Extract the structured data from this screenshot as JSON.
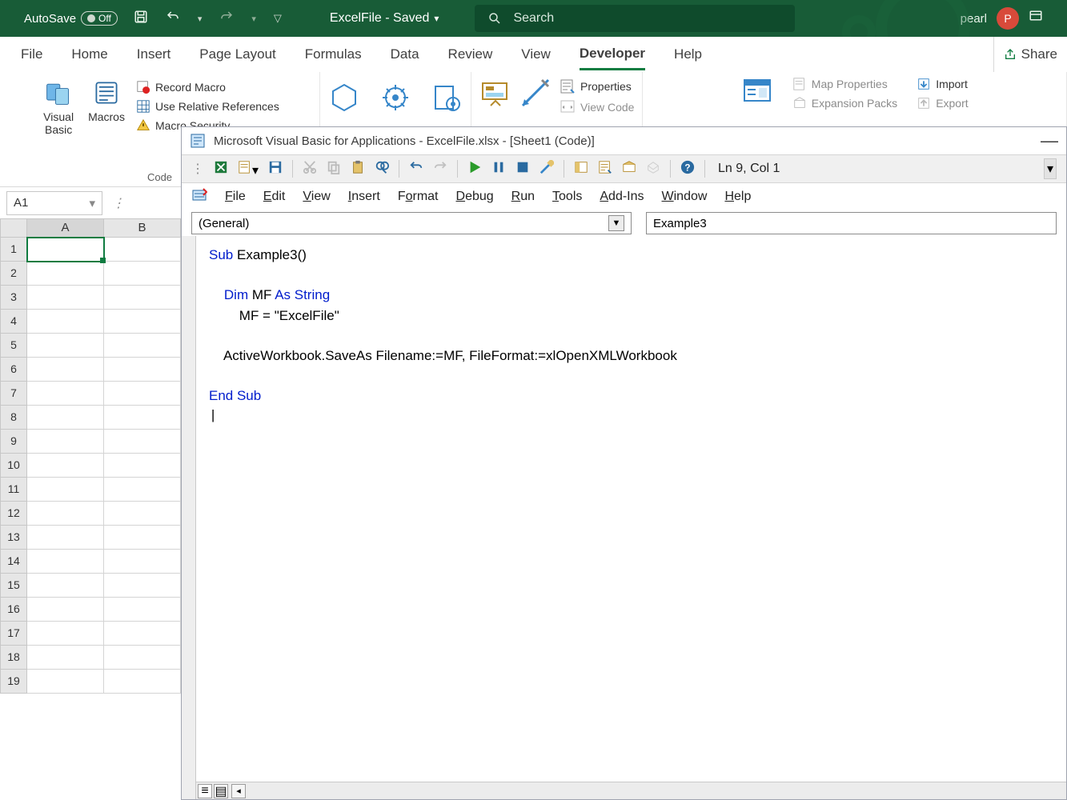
{
  "titlebar": {
    "autosave_label": "AutoSave",
    "autosave_state": "Off",
    "doc_title": "ExcelFile - Saved",
    "search_placeholder": "Search",
    "user_name": "pearl",
    "user_initial": "P"
  },
  "tabs": [
    "File",
    "Home",
    "Insert",
    "Page Layout",
    "Formulas",
    "Data",
    "Review",
    "View",
    "Developer",
    "Help"
  ],
  "active_tab": "Developer",
  "share_label": "Share",
  "ribbon": {
    "code_group": "Code",
    "visual_basic": "Visual\nBasic",
    "macros": "Macros",
    "record_macro": "Record Macro",
    "use_relative": "Use Relative References",
    "macro_security": "Macro Security",
    "controls": {
      "properties": "Properties",
      "view_code": "View Code"
    },
    "xml": {
      "map_properties": "Map Properties",
      "expansion_packs": "Expansion Packs",
      "import": "Import",
      "export": "Export"
    }
  },
  "namebox_value": "A1",
  "grid": {
    "columns": [
      "A",
      "B"
    ],
    "rows": [
      "1",
      "2",
      "3",
      "4",
      "5",
      "6",
      "7",
      "8",
      "9",
      "10",
      "11",
      "12",
      "13",
      "14",
      "15",
      "16",
      "17",
      "18",
      "19"
    ]
  },
  "vbe": {
    "title": "Microsoft Visual Basic for Applications - ExcelFile.xlsx - [Sheet1 (Code)]",
    "position": "Ln 9, Col 1",
    "menubar": [
      "File",
      "Edit",
      "View",
      "Insert",
      "Format",
      "Debug",
      "Run",
      "Tools",
      "Add-Ins",
      "Window",
      "Help"
    ],
    "dd_left": "(General)",
    "dd_right": "Example3",
    "code": {
      "l1a": "Sub ",
      "l1b": "Example3()",
      "l2a": "    Dim ",
      "l2b": "MF ",
      "l2c": "As String",
      "l3": "        MF = \"ExcelFile\"",
      "l4": "    ActiveWorkbook.SaveAs Filename:=MF, FileFormat:=xlOpenXMLWorkbook",
      "l5": "End Sub"
    }
  }
}
